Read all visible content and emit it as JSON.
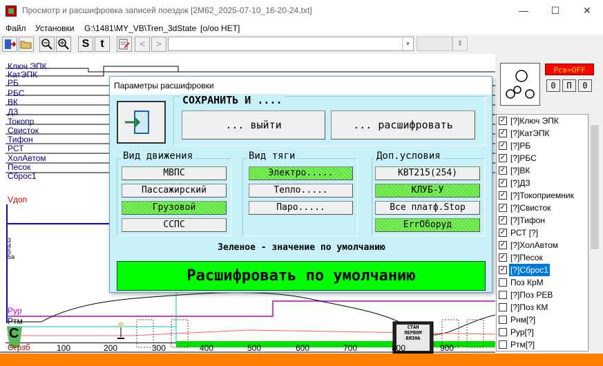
{
  "window": {
    "title": "Просмотр и расшифровка записей поездок [2M62_2025-07-10_16-20-24.txt]",
    "minimize": "—",
    "maximize": "☐",
    "close": "✕"
  },
  "menu": {
    "file": "Файл",
    "settings": "Установки",
    "path": "G:\\1481\\MY_VB\\Tren_3dState",
    "mode": "[o/oo HET]"
  },
  "toolbar": {
    "s_label": "S",
    "t_label": "t",
    "prev": "<",
    "next": ">",
    "combo_value": ""
  },
  "chart": {
    "signals": [
      "Ключ ЭПК",
      "КатЭПК",
      "РБ",
      "РБС",
      "ВК",
      "ДЗ",
      "Токопр",
      "Свисток",
      "Тифон",
      "РСТ",
      "ХолАвтом",
      "Песок",
      "Сброс1"
    ],
    "vdop": "Vдоп",
    "small_labels": [
      "3",
      "4",
      "5",
      "5a"
    ],
    "pur": "Рур",
    "rtm": "Ртм",
    "c_mark": "С",
    "x_ticks": [
      "100",
      "200",
      "300",
      "400",
      "500",
      "600",
      "700",
      "800",
      "900"
    ],
    "bottom_label": "Огрзб",
    "sign_lines": [
      "СТАН",
      "ПЕРВОМ",
      "ВЯЗНА"
    ]
  },
  "right_panel": {
    "status": "Рсв=OFF",
    "opp": [
      "0",
      "П",
      "0"
    ]
  },
  "signal_list": [
    {
      "label": "[?]Ключ ЭПК",
      "checked": true
    },
    {
      "label": "[?]КатЭПК",
      "checked": true
    },
    {
      "label": "[?]РБ",
      "checked": true
    },
    {
      "label": "[?]РБС",
      "checked": true
    },
    {
      "label": "[?]ВК",
      "checked": true
    },
    {
      "label": "[?]ДЗ",
      "checked": true
    },
    {
      "label": "[?]Токоприемник",
      "checked": true
    },
    {
      "label": "[?]Свисток",
      "checked": true
    },
    {
      "label": "[?]Тифон",
      "checked": true
    },
    {
      "label": "РСТ [?]",
      "checked": true
    },
    {
      "label": "[?]ХолАвтом",
      "checked": true
    },
    {
      "label": "[?]Песок",
      "checked": true
    },
    {
      "label": "[?]Сброс1",
      "checked": true,
      "selected": true
    },
    {
      "label": "Поз КрМ",
      "checked": false
    },
    {
      "label": "[?]Поз РЕВ",
      "checked": false
    },
    {
      "label": "[?]Поз КМ",
      "checked": false
    },
    {
      "label": "Рнм[?]",
      "checked": false
    },
    {
      "label": "Рур[?]",
      "checked": false
    },
    {
      "label": "Ртм[?]",
      "checked": false
    }
  ],
  "dialog": {
    "title": "Параметры расшифровки",
    "save_header": "СОХРАНИТЬ И ....",
    "exit_btn": "... выйти",
    "decode_btn": "... расшифровать",
    "motion": {
      "title": "Вид движения",
      "options": [
        {
          "label": "МВПС",
          "default": false
        },
        {
          "label": "Пассажирский",
          "default": false
        },
        {
          "label": "Грузовой",
          "default": true
        },
        {
          "label": "ССПС",
          "default": false
        }
      ]
    },
    "traction": {
      "title": "Вид тяги",
      "options": [
        {
          "label": "Электро.....",
          "default": true
        },
        {
          "label": "Тепло.....",
          "default": false
        },
        {
          "label": "Паро.....",
          "default": false
        }
      ]
    },
    "extra": {
      "title": "Доп.условия",
      "options": [
        {
          "label": "КВТ215(254)",
          "default": false
        },
        {
          "label": "КЛУБ-У",
          "default": true
        },
        {
          "label": "Все платф.Stop",
          "default": false
        },
        {
          "label": "ErrОборуд",
          "default": true
        }
      ]
    },
    "hint": "Зеленое - значение по умолчанию",
    "default_btn": "Расшифровать по умолчанию",
    "colors": {
      "default_green": "#60e040",
      "big_green": "#00ff00",
      "dialog_bg": "#c8f0f8"
    }
  }
}
